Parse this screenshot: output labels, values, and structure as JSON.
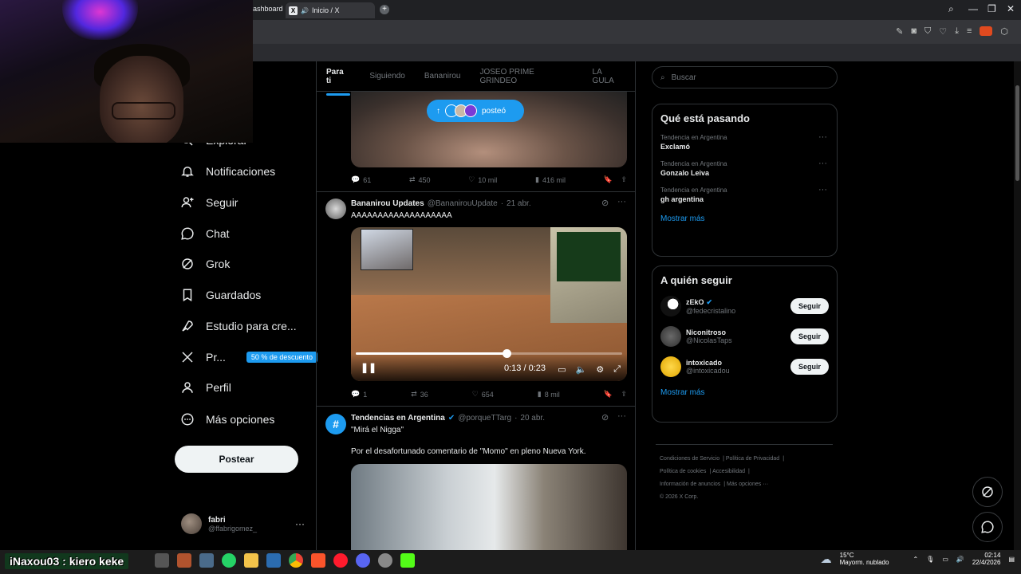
{
  "browser": {
    "prev_tab_label": "ashboard",
    "active_tab_label": "Inicio / X"
  },
  "sidebar": {
    "items": [
      {
        "label": "Explorar",
        "icon": "search-icon"
      },
      {
        "label": "Notificaciones",
        "icon": "bell-icon"
      },
      {
        "label": "Seguir",
        "icon": "person-add-icon"
      },
      {
        "label": "Chat",
        "icon": "chat-icon"
      },
      {
        "label": "Grok",
        "icon": "grok-icon"
      },
      {
        "label": "Guardados",
        "icon": "bookmark-icon"
      },
      {
        "label": "Estudio para cre...",
        "icon": "rocket-icon"
      },
      {
        "label": "Pr...",
        "icon": "x-logo-icon",
        "badge": "50 % de descuento"
      },
      {
        "label": "Perfil",
        "icon": "person-icon"
      },
      {
        "label": "Más opciones",
        "icon": "more-circle-icon"
      }
    ],
    "post_button": "Postear",
    "user": {
      "name": "fabri",
      "handle": "@ffabrigomez_"
    }
  },
  "feed": {
    "tabs": [
      "Para ti",
      "Siguiendo",
      "Bananirou",
      "JOSEO PRIME GRINDEO",
      "LA GULA"
    ],
    "new_posts_pill": "posteó",
    "post1": {
      "replies": "61",
      "reposts": "450",
      "likes": "10 mil",
      "views": "416 mil"
    },
    "post2": {
      "author": "Bananirou Updates",
      "handle": "@BananirouUpdate",
      "date": "21 abr.",
      "text": "AAAAAAAAAAAAAAAAAAA",
      "video_time": "0:13 / 0:23",
      "progress": 0.565,
      "replies": "1",
      "reposts": "36",
      "likes": "654",
      "views": "8 mil"
    },
    "post3": {
      "author": "Tendencias en Argentina",
      "handle": "@porqueTTarg",
      "date": "20 abr.",
      "text1": "\"Mirá el Nigga\"",
      "text2": "Por el desafortunado comentario de \"Momo\" en pleno Nueva York."
    }
  },
  "right": {
    "search_placeholder": "Buscar",
    "trends_title": "Qué está pasando",
    "trends": [
      {
        "caption": "Tendencia en Argentina",
        "topic": "Exclamó"
      },
      {
        "caption": "Tendencia en Argentina",
        "topic": "Gonzalo Leiva"
      },
      {
        "caption": "Tendencia en Argentina",
        "topic": "gh argentina"
      }
    ],
    "show_more": "Mostrar más",
    "follow_title": "A quién seguir",
    "follow": [
      {
        "name": "zEkO",
        "handle": "@fedecristalino",
        "verified": true
      },
      {
        "name": "Niconitroso",
        "handle": "@NicolasTaps",
        "verified": false
      },
      {
        "name": "intoxicado",
        "handle": "@intoxicadou",
        "verified": false
      }
    ],
    "follow_button": "Seguir",
    "legal": [
      "Condiciones de Servicio",
      "Política de Privacidad",
      "Política de cookies",
      "Accesibilidad",
      "Información de anuncios",
      "Más opciones ···",
      "© 2026 X Corp."
    ]
  },
  "taskbar": {
    "overlay": "iNaxou03 : kiero keke",
    "weather_temp": "15°C",
    "weather_desc": "Mayorm. nublado",
    "time": "02:14",
    "date": "22/4/2026"
  },
  "colors": {
    "accent": "#1d9bf0",
    "bg": "#000000",
    "border": "#2f3336",
    "muted": "#71767b"
  }
}
